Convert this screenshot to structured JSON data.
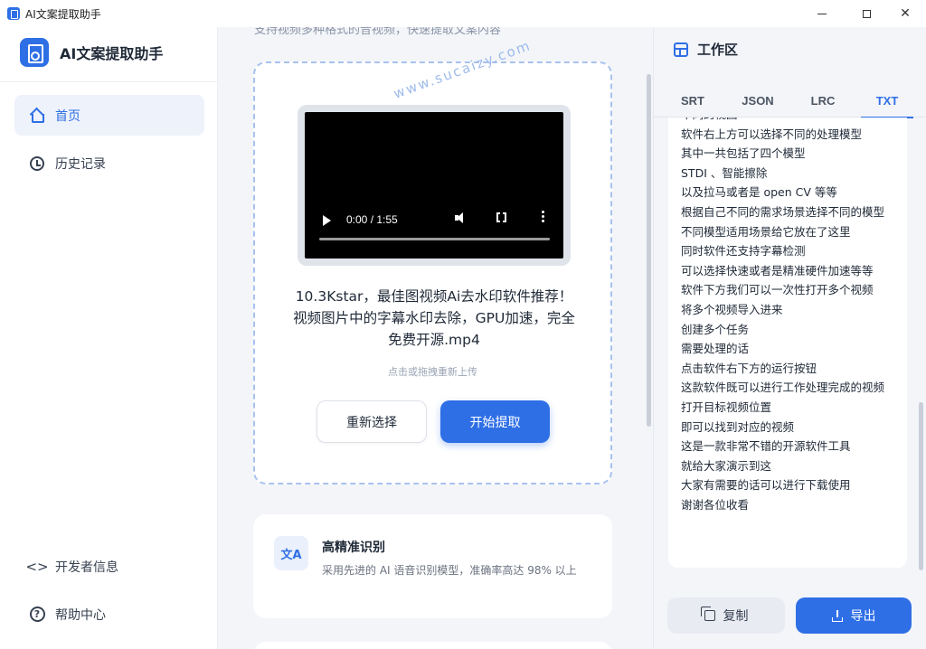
{
  "window": {
    "title": "AI文案提取助手",
    "minimize_label": "—",
    "maximize_label": "☐",
    "close_label": "✕"
  },
  "sidebar": {
    "brand": "AI文案提取助手",
    "nav": [
      {
        "label": "首页",
        "icon": "home-icon",
        "active": true
      },
      {
        "label": "历史记录",
        "icon": "clock-icon",
        "active": false
      }
    ],
    "footer": [
      {
        "label": "开发者信息",
        "icon": "code-icon",
        "glyph": "<>"
      },
      {
        "label": "帮助中心",
        "icon": "help-icon",
        "glyph": "?"
      }
    ]
  },
  "main": {
    "top_text": "支持视频多种格式的音视频，快速提取文案内容",
    "watermark": "www.sucaizy.com",
    "upload": {
      "video_time": "0:00 / 1:55",
      "file_name": "10.3Kstar，最佳图视频Ai去水印软件推荐！视频图片中的字幕水印去除，GPU加速，完全免费开源.mp4",
      "hint": "点击或拖拽重新上传",
      "reselect_label": "重新选择",
      "start_label": "开始提取"
    },
    "feature": {
      "icon_glyph": "文A",
      "title": "高精准识别",
      "desc": "采用先进的 AI 语音识别模型，准确率高达 98% 以上"
    }
  },
  "workspace": {
    "title": "工作区",
    "tabs": [
      "SRT",
      "JSON",
      "LRC",
      "TXT"
    ],
    "active_tab": "TXT",
    "lines": [
      "不同的视图",
      "软件右上方可以选择不同的处理模型",
      "其中一共包括了四个模型",
      "STDI 、智能擦除",
      "以及拉马或者是 open CV 等等",
      "根据自己不同的需求场景选择不同的模型",
      "不同模型适用场景给它放在了这里",
      "同时软件还支持字幕检测",
      "可以选择快速或者是精准硬件加速等等",
      "软件下方我们可以一次性打开多个视频",
      "将多个视频导入进来",
      "创建多个任务",
      "需要处理的话",
      "点击软件右下方的运行按钮",
      "这款软件既可以进行工作处理完成的视频",
      "打开目标视频位置",
      "即可以找到对应的视频",
      "这是一款非常不错的开源软件工具",
      "就给大家演示到这",
      "大家有需要的话可以进行下载使用",
      "谢谢各位收看"
    ],
    "copy_label": "复制",
    "export_label": "导出"
  },
  "colors": {
    "accent": "#2f6fe6",
    "background": "#f3f5f9",
    "active_nav_bg": "#eef2fb"
  }
}
